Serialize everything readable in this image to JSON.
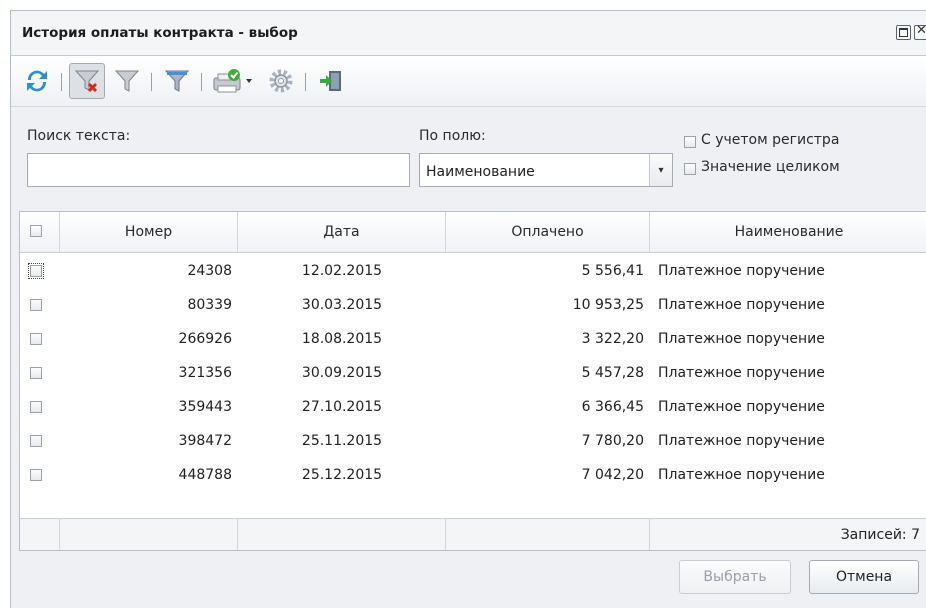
{
  "window": {
    "title": "История оплаты контракта - выбор"
  },
  "toolbar": {
    "icons": [
      "refresh-icon",
      "clear-filter-icon",
      "filter-icon",
      "filter-settings-icon",
      "print-icon",
      "settings-icon",
      "exit-icon"
    ]
  },
  "search": {
    "text_label": "Поиск текста:",
    "text_value": "",
    "field_label": "По полю:",
    "field_value": "Наименование",
    "case_label": "С учетом регистра",
    "whole_label": "Значение целиком"
  },
  "table": {
    "columns": [
      "Номер",
      "Дата",
      "Оплачено",
      "Наименование"
    ],
    "rows": [
      [
        "24308",
        "12.02.2015",
        "5 556,41",
        "Платежное поручение"
      ],
      [
        "80339",
        "30.03.2015",
        "10 953,25",
        "Платежное поручение"
      ],
      [
        "266926",
        "18.08.2015",
        "3 322,20",
        "Платежное поручение"
      ],
      [
        "321356",
        "30.09.2015",
        "5 457,28",
        "Платежное поручение"
      ],
      [
        "359443",
        "27.10.2015",
        "6 366,45",
        "Платежное поручение"
      ],
      [
        "398472",
        "25.11.2015",
        "7 780,20",
        "Платежное поручение"
      ],
      [
        "448788",
        "25.12.2015",
        "7 042,20",
        "Платежное поручение"
      ]
    ],
    "footer_count": "Записей: 7"
  },
  "buttons": {
    "select": "Выбрать",
    "cancel": "Отмена"
  }
}
